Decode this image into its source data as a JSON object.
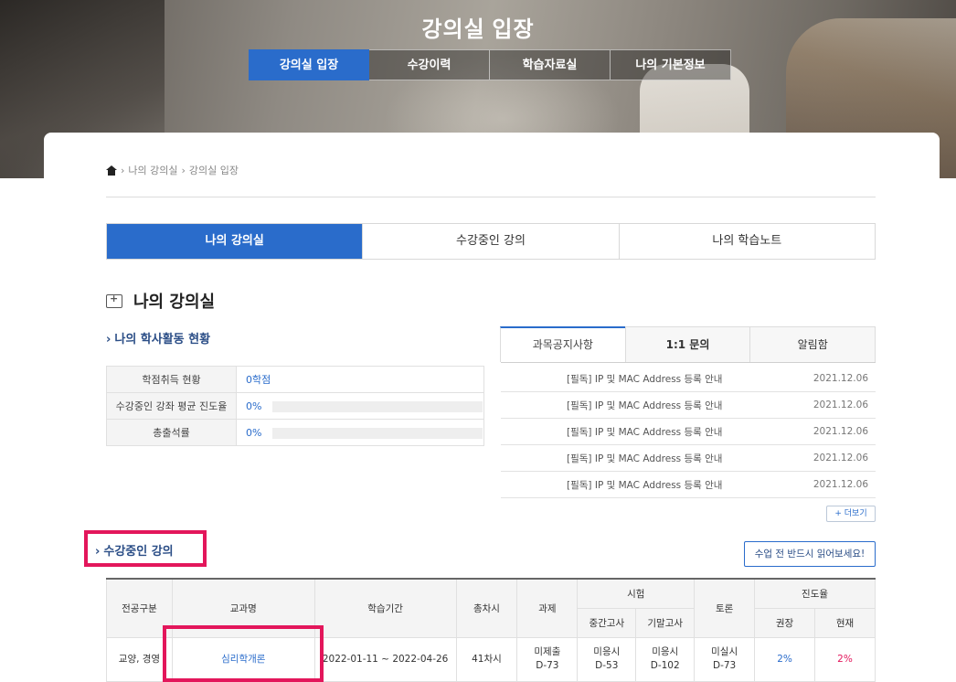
{
  "hero": {
    "title": "강의실 입장",
    "nav": [
      "강의실 입장",
      "수강이력",
      "학습자료실",
      "나의 기본정보"
    ]
  },
  "breadcrumb": [
    "나의 강의실",
    "강의실 입장"
  ],
  "subtabs": [
    "나의 강의실",
    "수강중인 강의",
    "나의 학습노트"
  ],
  "section_title": "나의 강의실",
  "activity": {
    "heading": "나의 학사활동 현황",
    "rows": [
      {
        "label": "학점취득 현황",
        "value": "0학점",
        "progress": null
      },
      {
        "label": "수강중인 강좌 평균 진도율",
        "value": "0%",
        "progress": 0
      },
      {
        "label": "총출석률",
        "value": "0%",
        "progress": 0
      }
    ]
  },
  "notices": {
    "tabs": [
      "과목공지사항",
      "1:1 문의",
      "알림함"
    ],
    "items": [
      {
        "title": "[필독] IP 및 MAC Address 등록 안내",
        "date": "2021.12.06"
      },
      {
        "title": "[필독] IP 및 MAC Address 등록 안내",
        "date": "2021.12.06"
      },
      {
        "title": "[필독] IP 및 MAC Address 등록 안내",
        "date": "2021.12.06"
      },
      {
        "title": "[필독] IP 및 MAC Address 등록 안내",
        "date": "2021.12.06"
      },
      {
        "title": "[필독] IP 및 MAC Address 등록 안내",
        "date": "2021.12.06"
      }
    ],
    "more_label": "+ 더보기"
  },
  "courses": {
    "heading": "수강중인 강의",
    "read_button": "수업 전 반드시 읽어보세요!",
    "headers": {
      "major": "전공구분",
      "name": "교과명",
      "period": "학습기간",
      "total": "총차시",
      "assignment": "과제",
      "exam": "시험",
      "midterm": "중간고사",
      "final": "기말고사",
      "discussion": "토론",
      "progress": "진도율",
      "recommended": "권장",
      "current": "현재"
    },
    "rows": [
      {
        "major": "교양, 경영",
        "name": "심리학개론",
        "period": "2022-01-11 ~ 2022-04-26",
        "total": "41차시",
        "assignment": [
          "미제출",
          "D-73"
        ],
        "midterm": [
          "미응시",
          "D-53"
        ],
        "final": [
          "미응시",
          "D-102"
        ],
        "discussion": [
          "미실시",
          "D-73"
        ],
        "recommended": "2%",
        "current": "2%"
      }
    ]
  },
  "colors": {
    "primary": "#2a6ccb",
    "highlight": "#e3165b"
  }
}
